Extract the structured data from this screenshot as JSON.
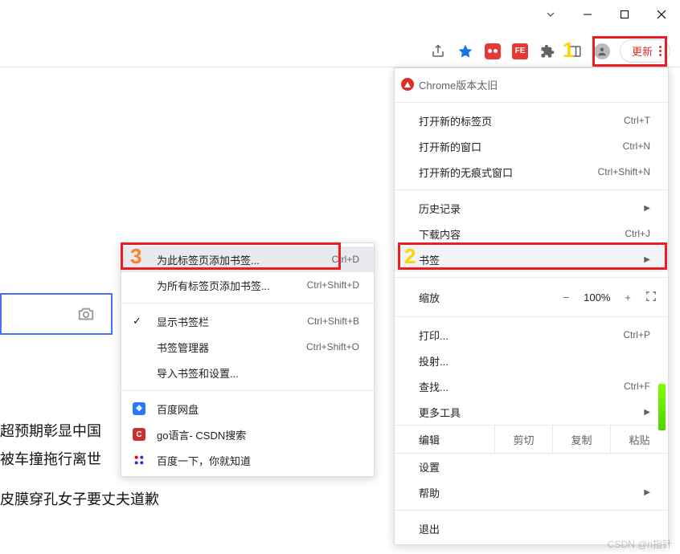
{
  "window_controls": {
    "minimize": "−",
    "maximize": "▢",
    "close": "✕"
  },
  "toolbar": {
    "share": "share-icon",
    "star": "star-icon",
    "ext1": "red-dots",
    "ext2_label": "FE",
    "puzzle": "extensions-icon",
    "panel": "side-panel-icon",
    "profile": "profile-avatar",
    "update_label": "更新"
  },
  "menu": {
    "version_warning": "Chrome版本太旧",
    "new_tab": {
      "label": "打开新的标签页",
      "shortcut": "Ctrl+T"
    },
    "new_window": {
      "label": "打开新的窗口",
      "shortcut": "Ctrl+N"
    },
    "incognito": {
      "label": "打开新的无痕式窗口",
      "shortcut": "Ctrl+Shift+N"
    },
    "history": {
      "label": "历史记录"
    },
    "downloads": {
      "label": "下载内容",
      "shortcut": "Ctrl+J"
    },
    "bookmarks": {
      "label": "书签"
    },
    "zoom": {
      "label": "缩放",
      "minus": "−",
      "pct": "100%",
      "plus": "+"
    },
    "print": {
      "label": "打印...",
      "shortcut": "Ctrl+P"
    },
    "cast": {
      "label": "投射..."
    },
    "find": {
      "label": "查找...",
      "shortcut": "Ctrl+F"
    },
    "more_tools": {
      "label": "更多工具"
    },
    "edit": {
      "label": "编辑",
      "cut": "剪切",
      "copy": "复制",
      "paste": "粘贴"
    },
    "settings": {
      "label": "设置"
    },
    "help": {
      "label": "帮助"
    },
    "exit": {
      "label": "退出"
    }
  },
  "submenu": {
    "bookmark_tab": {
      "label": "为此标签页添加书签...",
      "shortcut": "Ctrl+D"
    },
    "bookmark_all": {
      "label": "为所有标签页添加书签...",
      "shortcut": "Ctrl+Shift+D"
    },
    "show_bar": {
      "label": "显示书签栏",
      "shortcut": "Ctrl+Shift+B"
    },
    "manager": {
      "label": "书签管理器",
      "shortcut": "Ctrl+Shift+O"
    },
    "import": {
      "label": "导入书签和设置..."
    },
    "bk1": {
      "label": "百度网盘"
    },
    "bk2": {
      "label": "go语言- CSDN搜索"
    },
    "bk3": {
      "label": "百度一下，你就知道"
    }
  },
  "page": {
    "line1": "超预期彰显中国",
    "line2": "被车撞拖行离世",
    "line3": "皮膜穿孔女子要丈夫道歉"
  },
  "annotations": {
    "n1": "1",
    "n2": "2",
    "n3": "3"
  },
  "watermark": "CSDN @n指针"
}
